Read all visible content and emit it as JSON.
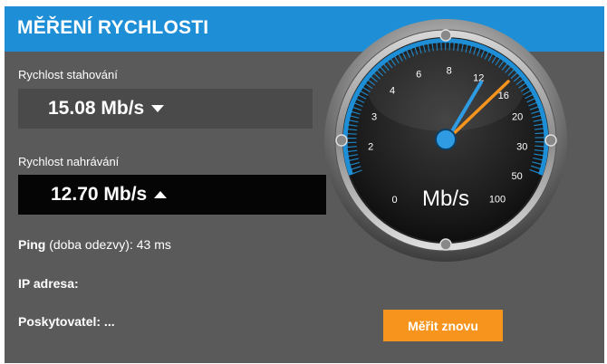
{
  "header": {
    "title": "MĚŘENÍ RYCHLOSTI"
  },
  "download": {
    "label": "Rychlost stahování",
    "value": "15.08 Mb/s",
    "icon": "arrow-down-icon"
  },
  "upload": {
    "label": "Rychlost nahrávání",
    "value": "12.70 Mb/s",
    "icon": "arrow-up-icon"
  },
  "ping": {
    "label_bold": "Ping",
    "label_rest": " (doba odezvy): 43 ms"
  },
  "ip": {
    "label": "IP adresa:"
  },
  "provider": {
    "label": "Poskytovatel: ..."
  },
  "retest_button": {
    "label": "Měřit znovu"
  },
  "gauge": {
    "unit": "Mb/s",
    "ticks": [
      "0",
      "2",
      "3",
      "4",
      "6",
      "8",
      "12",
      "16",
      "20",
      "30",
      "50",
      "100"
    ],
    "needle_value_mbps": 12.7,
    "peak_value_mbps": 15.08,
    "colors": {
      "accent": "#1e8fd6",
      "needle_primary": "#2e9be3",
      "needle_secondary": "#f7941d"
    }
  },
  "colors": {
    "header": "#1e8fd6",
    "panel": "#5a5a5a",
    "button": "#f7941d"
  }
}
